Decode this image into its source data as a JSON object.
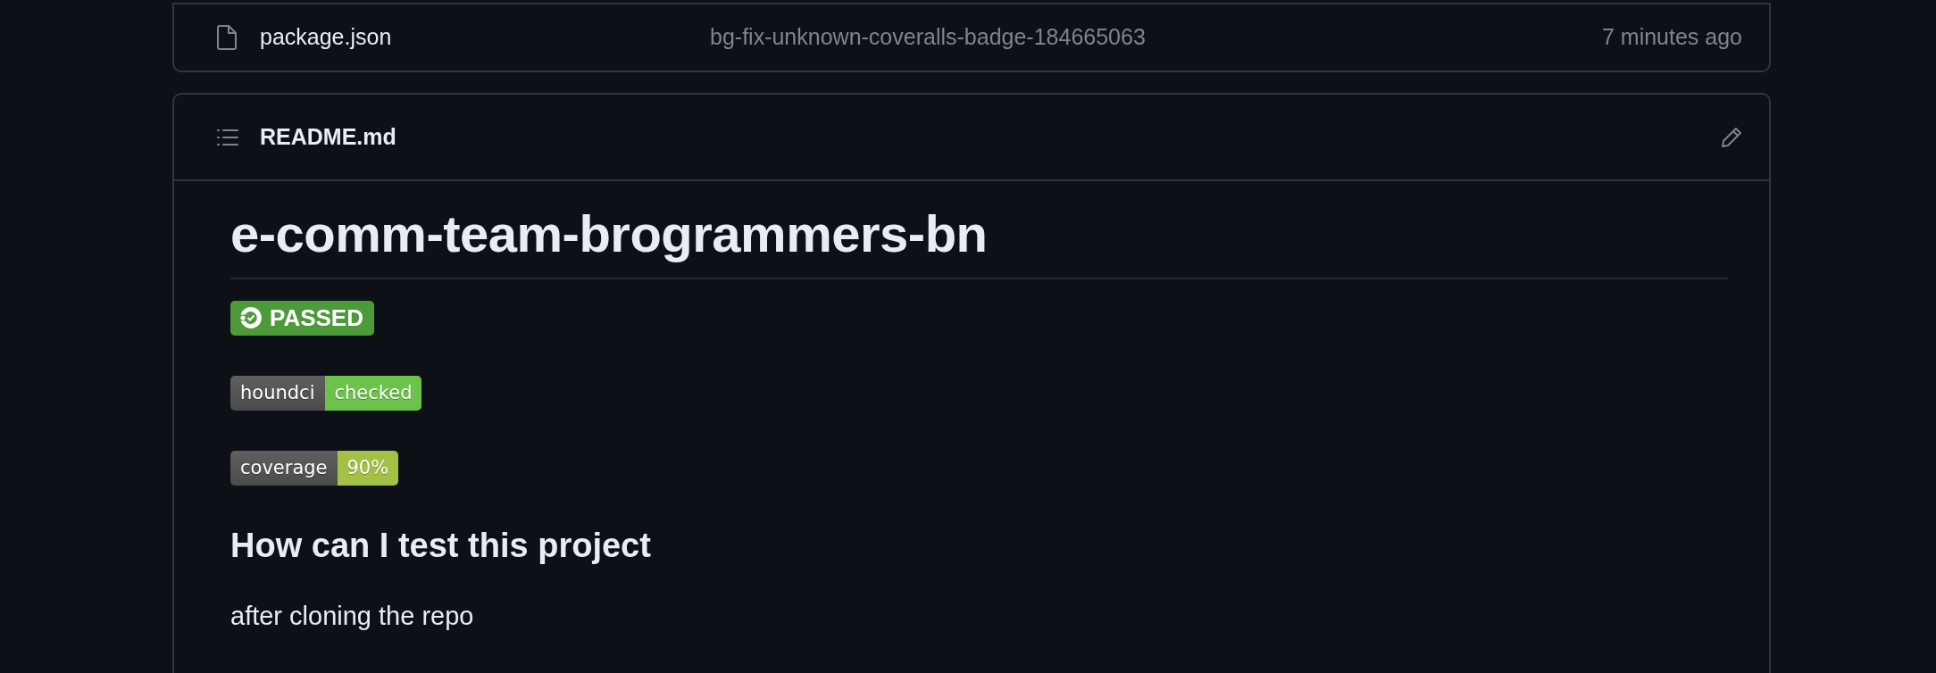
{
  "file_row": {
    "name": "package.json",
    "commit_message": "bg-fix-unknown-coveralls-badge-184665063",
    "time": "7 minutes ago"
  },
  "readme": {
    "filename": "README.md",
    "title": "e-comm-team-brogrammers-bn",
    "badges": [
      {
        "kind": "ci",
        "text": "PASSED",
        "color": "#4c9a3a"
      },
      {
        "kind": "shield",
        "label": "houndci",
        "value": "checked",
        "color": "#6cc24a"
      },
      {
        "kind": "shield",
        "label": "coverage",
        "value": "90%",
        "color": "#a3c144"
      }
    ],
    "heading": "How can I test this project",
    "paragraph": "after cloning the repo"
  }
}
